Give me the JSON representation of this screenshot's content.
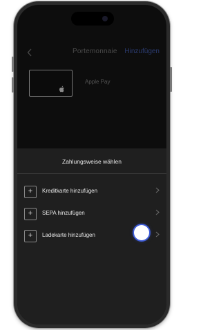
{
  "nav": {
    "back_icon": "chevron-left-icon",
    "title": "Portemonnaie",
    "add_label": "Hinzufügen",
    "add_color": "#2c3c72"
  },
  "wallet": {
    "card_icon": "apple-logo-icon",
    "card_label": "Apple Pay"
  },
  "sheet": {
    "title": "Zahlungsweise wählen",
    "items": [
      {
        "icon": "plus-icon",
        "label": "Kreditkarte hinzufügen",
        "chevron": "chevron-right-icon"
      },
      {
        "icon": "plus-icon",
        "label": "SEPA hinzufügen",
        "chevron": "chevron-right-icon"
      },
      {
        "icon": "plus-icon",
        "label": "Ladekarte hinzufügen",
        "chevron": "chevron-right-icon"
      }
    ],
    "background": "#1f1f1f"
  },
  "touch_indicator": {
    "color": "#ffffff",
    "ring_color": "#3d5bd6"
  }
}
